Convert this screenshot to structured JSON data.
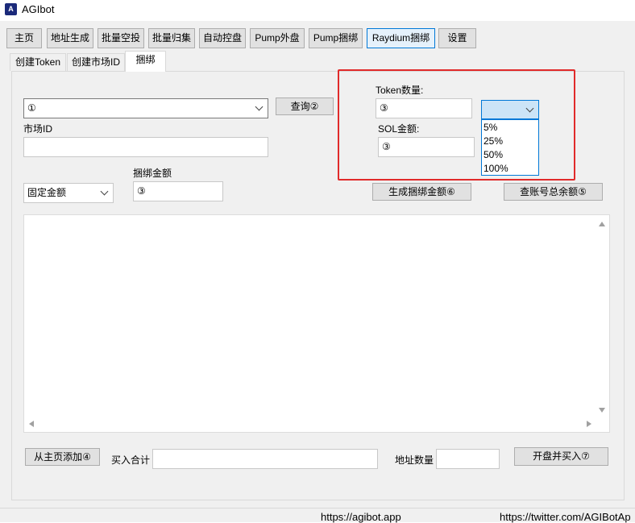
{
  "window": {
    "title": "AGIbot",
    "icon": "agibot-logo-icon"
  },
  "nav": {
    "items": [
      {
        "label": "主页"
      },
      {
        "label": "地址生成"
      },
      {
        "label": "批量空投"
      },
      {
        "label": "批量归集"
      },
      {
        "label": "自动控盘"
      },
      {
        "label": "Pump外盘"
      },
      {
        "label": "Pump捆绑"
      },
      {
        "label": "Raydium捆绑"
      },
      {
        "label": "设置"
      }
    ],
    "active_index": 7
  },
  "tabs": {
    "items": [
      {
        "label": "创建Token"
      },
      {
        "label": "创建市场ID"
      },
      {
        "label": "捆绑"
      }
    ],
    "active_index": 2
  },
  "form": {
    "market_select_value": "①",
    "query_button": "查询②",
    "market_id_label": "市场ID",
    "market_id_value": "",
    "amount_mode_value": "固定金额",
    "bundle_amount_label": "捆绑金额",
    "bundle_amount_value": "③",
    "token_qty_label": "Token数量:",
    "token_qty_value": "③",
    "pct_select_value": "",
    "pct_options": [
      "5%",
      "25%",
      "50%",
      "100%"
    ],
    "sol_amount_label": "SOL金额:",
    "sol_amount_value": "③",
    "gen_bundle_button": "生成捆绑金额⑥",
    "check_balance_button": "查账号总余额⑤"
  },
  "log": {
    "content": ""
  },
  "bottom": {
    "add_from_main_button": "从主页添加④",
    "buy_total_label": "买入合计",
    "buy_total_value": "",
    "address_count_label": "地址数量",
    "address_count_value": "",
    "open_buy_button": "开盘并买入⑦"
  },
  "status": {
    "left_link": "https://agibot.app",
    "right_link": "https://twitter.com/AGIBotAp"
  },
  "colors": {
    "highlight_border": "#e12a2a",
    "active_accent": "#0078d7",
    "select_selected_bg": "#cce4f7"
  }
}
